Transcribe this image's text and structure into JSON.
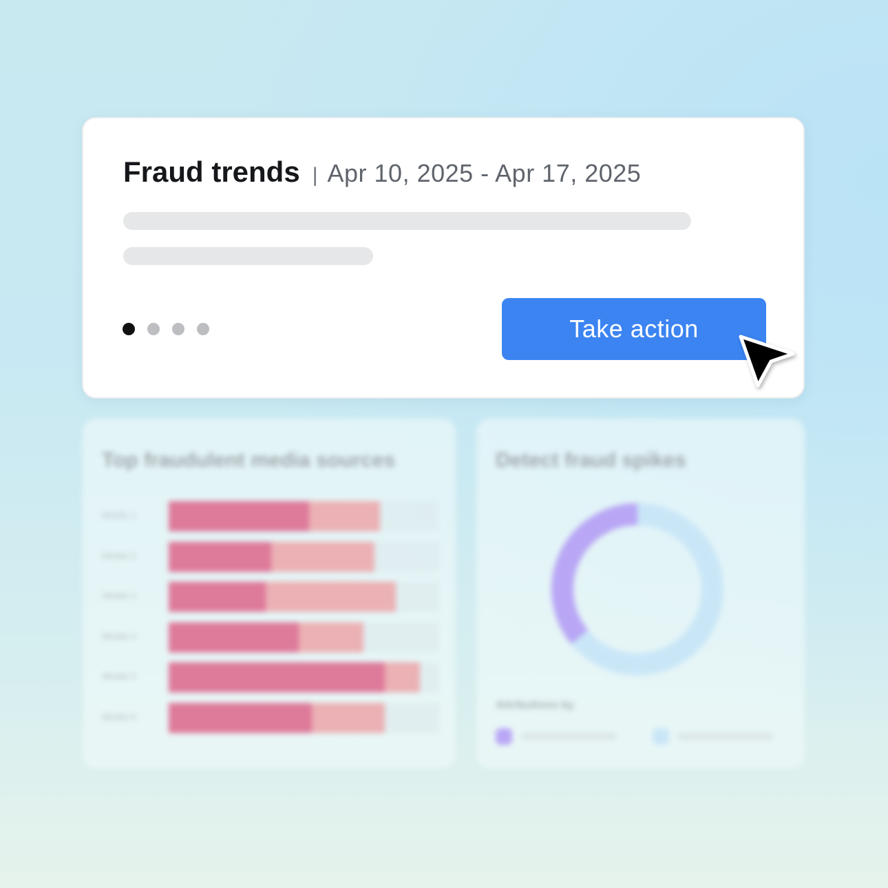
{
  "fraud_trends_card": {
    "title": "Fraud trends",
    "separator": "|",
    "date_range": "Apr 10, 2025 - Apr 17, 2025",
    "pager": {
      "total": 4,
      "active_index": 0
    },
    "primary_button": "Take action",
    "icons": {
      "cursor": "mouse-pointer-icon"
    }
  },
  "media_sources_card": {
    "title": "Top fraudulent media sources",
    "chart_data": {
      "type": "bar",
      "stacked": true,
      "orientation": "horizontal",
      "categories": [
        "Media 1",
        "Media 2",
        "Media 3",
        "Media 4",
        "Media 5",
        "Media 6"
      ],
      "series": [
        {
          "values": [
            0.52,
            0.38,
            0.36,
            0.48,
            0.8,
            0.53
          ]
        },
        {
          "values": [
            0.26,
            0.38,
            0.48,
            0.24,
            0.13,
            0.27
          ]
        }
      ],
      "xlim": [
        0,
        1
      ]
    }
  },
  "fraud_spikes_card": {
    "title": "Detect fraud spikes",
    "chart_data": {
      "type": "pie",
      "donut": true,
      "values": [
        0.36,
        0.64
      ]
    },
    "attributions_label": "Attributions by"
  },
  "colors": {
    "primary_blue": "#3b84f2",
    "bar_primary": "#de7a9a",
    "bar_secondary": "#ebb1b4",
    "donut_purple": "#b9a6f5",
    "donut_light_blue": "#c9e6f7",
    "pager_active": "#111111",
    "pager_inactive": "#bdbec1"
  }
}
